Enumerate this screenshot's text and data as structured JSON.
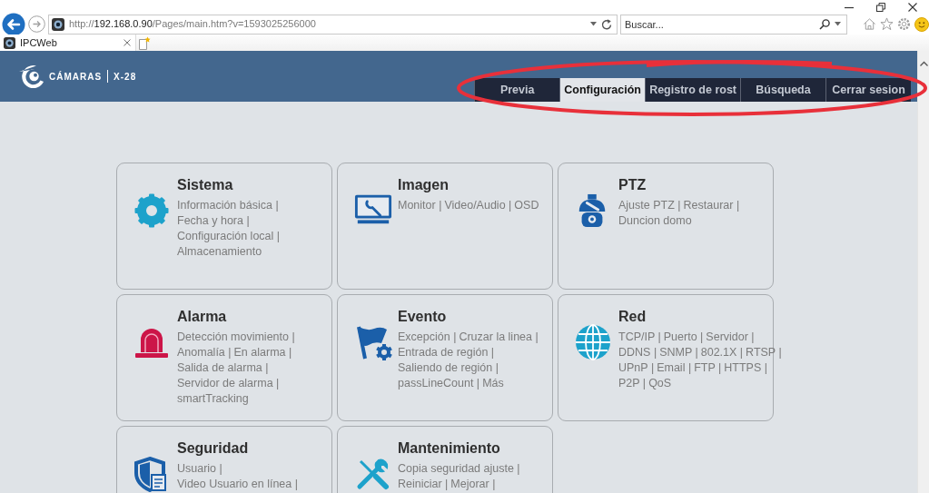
{
  "browser": {
    "address": "http://**192.168.0.90**/Pages/main.htm?v=1593025256000",
    "search": {
      "placeholder": "Buscar..."
    },
    "tab": {
      "title": "IPCWeb"
    }
  },
  "header": {
    "logo": {
      "brand": "CÁMARAS",
      "model": "X-28"
    },
    "nav": [
      {
        "label": "Previa",
        "selected": false
      },
      {
        "label": "Configuración",
        "selected": true
      },
      {
        "label": "Registro de rost",
        "selected": false
      },
      {
        "label": "Búsqueda",
        "selected": false
      },
      {
        "label": "Cerrar sesion",
        "selected": false
      }
    ]
  },
  "cards": [
    {
      "title": "Sistema",
      "lines": [
        [
          "Información básica |"
        ],
        [
          "Fecha y hora |"
        ],
        [
          "Configuración local |"
        ],
        [
          "Almacenamiento"
        ]
      ]
    },
    {
      "title": "Imagen",
      "lines": [
        [
          "Monitor |",
          "Video/Audio |",
          "OSD"
        ]
      ]
    },
    {
      "title": "PTZ",
      "lines": [
        [
          "Ajuste PTZ |",
          "Restaurar |"
        ],
        [
          "Duncion domo"
        ]
      ]
    },
    {
      "title": "Alarma",
      "lines": [
        [
          "Detección movimiento |"
        ],
        [
          "Anomalía |",
          "En alarma |"
        ],
        [
          "Salida de alarma |"
        ],
        [
          "Servidor de alarma |"
        ],
        [
          "smartTracking"
        ]
      ]
    },
    {
      "title": "Evento",
      "lines": [
        [
          "Excepción |",
          "Cruzar la linea |"
        ],
        [
          "Entrada de región |"
        ],
        [
          "Saliendo de región |"
        ],
        [
          "passLineCount |",
          "Más"
        ]
      ]
    },
    {
      "title": "Red",
      "lines": [
        [
          "TCP/IP |",
          "Puerto |",
          "Servidor |"
        ],
        [
          "DDNS |",
          "SNMP |",
          "802.1X |",
          "RTSP |"
        ],
        [
          "UPnP |",
          "Email |",
          "FTP |",
          "HTTPS |"
        ],
        [
          "P2P |",
          "QoS"
        ]
      ]
    },
    {
      "title": "Seguridad",
      "lines": [
        [
          "Usuario |"
        ],
        [
          "Video Usuario en línea |"
        ]
      ]
    },
    {
      "title": "Mantenimiento",
      "lines": [
        [
          "Copia seguridad ajuste  |"
        ],
        [
          "Reiniciar |",
          "Mejorar |"
        ]
      ]
    }
  ]
}
